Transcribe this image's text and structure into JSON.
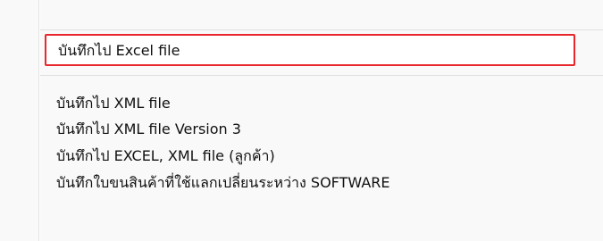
{
  "menu": {
    "items": [
      {
        "label": "บันทึกไป Excel file"
      },
      {
        "label": "บันทึกไป XML file"
      },
      {
        "label": "บันทึกไป XML file Version 3"
      },
      {
        "label": "บันทึกไป EXCEL, XML file (ลูกค้า)"
      },
      {
        "label": "บันทึกใบขนสินค้าที่ใช้แลกเปลี่ยนระหว่าง SOFTWARE"
      }
    ]
  },
  "colors": {
    "highlight_border": "#e8262b",
    "menu_background": "#f9f9f9"
  }
}
